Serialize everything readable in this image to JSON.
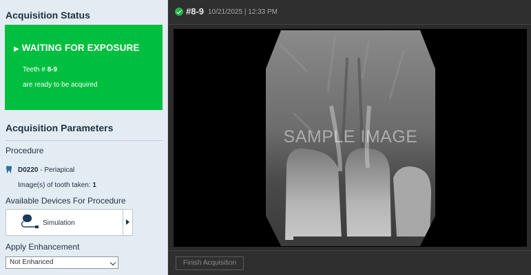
{
  "acquisition_status": {
    "title": "Acquisition Status",
    "headline": "WAITING FOR EXPOSURE",
    "teeth_label": "Teeth #",
    "teeth_value": "8-9",
    "message": "are ready to be acquired",
    "color": "#00bf3f"
  },
  "parameters": {
    "title": "Acquisition Parameters",
    "procedure_label": "Procedure",
    "procedure_code": "D0220",
    "procedure_name": " - Periapical",
    "images_taken_label": "Image(s) of tooth  taken:",
    "images_taken_value": "1"
  },
  "devices": {
    "label": "Available Devices For Procedure",
    "device_name": "Simulation"
  },
  "enhancement": {
    "label": "Apply Enhancement",
    "selected": "Not Enhanced"
  },
  "viewer": {
    "image_id": "#8-9",
    "timestamp": "10/21/2025 | 12:33 PM",
    "watermark": "SAMPLE IMAGE",
    "status_icon": "check-circle-icon"
  },
  "footer": {
    "finish_label": "Finish Acquisition"
  }
}
